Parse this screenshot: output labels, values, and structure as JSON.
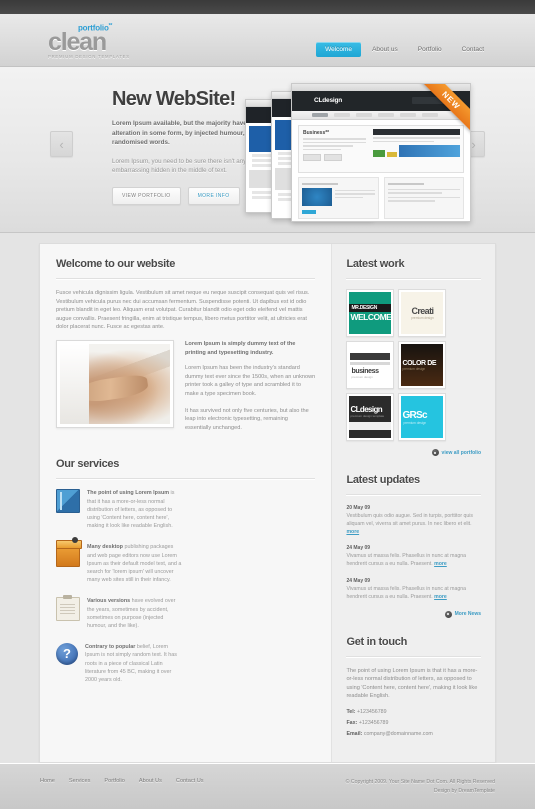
{
  "header": {
    "logo": {
      "top": "portfolio",
      "sup": "**",
      "main": "clean",
      "tagline": "PREMIUM DESIGN TEMPLATES"
    },
    "nav": [
      {
        "label": "Welcome",
        "active": true
      },
      {
        "label": "About us",
        "active": false
      },
      {
        "label": "Portfolio",
        "active": false
      },
      {
        "label": "Contact",
        "active": false
      }
    ]
  },
  "hero": {
    "title": "New WebSite!",
    "lead": "Lorem Ipsum available, but the majority have suffered alteration in some form, by injected humour, or randomised words.",
    "sub": "Lorem Ipsum, you need to be sure there isn't anything embarrassing hidden in the middle of text.",
    "btn_primary": "VIEW PORTFOLIO",
    "btn_secondary": "MORE INFO",
    "ribbon": "NEW",
    "prev_arrow": "‹",
    "next_arrow": "›",
    "mock_logo": "CLdesign",
    "mock_heading": "Business**"
  },
  "welcome": {
    "title": "Welcome to our website",
    "paragraph": "Fusce vehicula dignissim ligula. Vestibulum sit amet neque eu neque suscipit consequat quis vel risus. Vestibulum vehicula purus nec dui accumsan fermentum. Suspendisse potenti. Ut dapibus est id odio pretium blandit in eget leo. Aliquam erat volutpat. Curabitur blandit odio eget odio eleifend vel mattis augue convallis. Praesent fringilla, enim at tristique tempus, libero metus porttitor velit, at ultricies erat dolor placerat nunc. Fusce ac egestas ante.",
    "media_lead": "Lorem Ipsum is simply dummy text of the printing and typesetting industry.",
    "media_p1": "Lorem Ipsum has been the industry's standard dummy text ever since the 1500s, when an unknown printer took a galley of type and scrambled it to make a type specimen book.",
    "media_p2": "It has survived not only five centuries, but also the leap into electronic typesetting, remaining essentially unchanged."
  },
  "services": {
    "title": "Our services",
    "items": [
      {
        "icon": "book-icon",
        "bold": "The point of using Lorem Ipsum",
        "text": " is that it has a more-or-less normal distribution of letters, as opposed to using 'Content here, content here', making it look like readable English."
      },
      {
        "icon": "box-icon",
        "bold": "Many desktop",
        "text": " publishing packages and web page editors now use Lorem Ipsum as their default model text, and a search for 'lorem ipsum' will uncover many web sites still in their infancy."
      },
      {
        "icon": "clipboard-icon",
        "bold": "Various versions",
        "text": " have evolved over the years, sometimes by accident, sometimes on purpose (injected humour, and the like)."
      },
      {
        "icon": "question-icon",
        "bold": "Contrary to popular",
        "text": " belief, Lorem Ipsum is not simply random text. It has roots in a piece of classical Latin literature from 45 BC, making it over 2000 years old."
      }
    ]
  },
  "latest_work": {
    "title": "Latest work",
    "thumbs": [
      {
        "name": "MR.DESIGN",
        "sub": "premium design",
        "big": "WELCOME"
      },
      {
        "name": "Creati",
        "sub": "premium design",
        "big": ""
      },
      {
        "name": "business",
        "sub": "premium design",
        "big": ""
      },
      {
        "name": "COLOR DE",
        "sub": "premium design",
        "big": ""
      },
      {
        "name": "CLdesign",
        "sub": "premium design template",
        "big": ""
      },
      {
        "name": "GRSc",
        "sub": "premium design",
        "big": ""
      }
    ],
    "link": "view all portfolio"
  },
  "latest_updates": {
    "title": "Latest updates",
    "items": [
      {
        "date": "20 May 09",
        "text": "Vestibulum quis odio augue. Sed in turpis, porttitor quis aliquam vel, viverra sit amet purus. In nec libero et elit. ",
        "more": "more"
      },
      {
        "date": "24 May 09",
        "text": "Vivamus ut massa felis. Phasellus in nunc at magna hendrerit cursus a eu nulla. Praesent. ",
        "more": "more"
      },
      {
        "date": "24 May 09",
        "text": "Vivamus ut massa felis. Phasellus in nunc at magna hendrerit cursus a eu nulla. Praesent. ",
        "more": "more"
      }
    ],
    "link": "More News"
  },
  "contact": {
    "title": "Get in touch",
    "paragraph": "The point of using Lorem Ipsum is that it has a more-or-less normal distribution of letters, as opposed to using 'Content here, content here', making it look like readable English.",
    "tel_label": "Tel:",
    "tel_value": "+123456789",
    "fax_label": "Fax:",
    "fax_value": "+123456789",
    "email_label": "Email:",
    "email_value": "company@domainname.com"
  },
  "footer": {
    "nav": [
      "Home",
      "Services",
      "Portfolio",
      "About Us",
      "Contact Us"
    ],
    "copyright": "© Copyright 2009. Your Site Name Dot Com. All Rights Reserved",
    "credit": "Design by DreamTemplate"
  },
  "colors": {
    "accent": "#2e9fd4",
    "ribbon": "#e8771a",
    "link": "#3d9cc4"
  }
}
